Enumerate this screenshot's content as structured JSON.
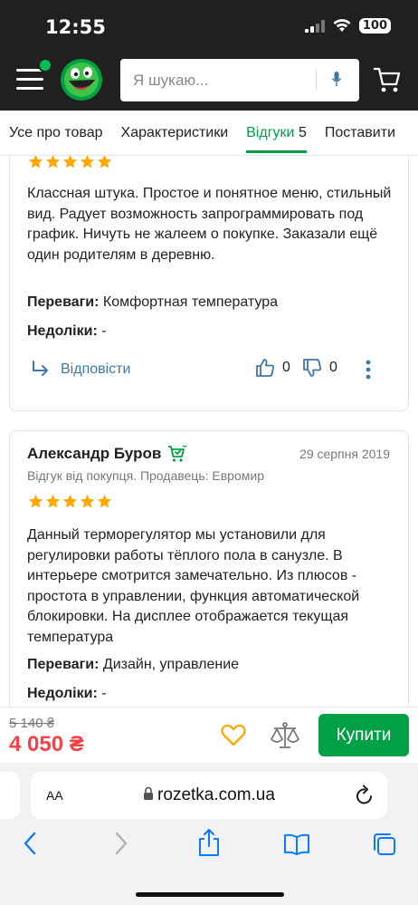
{
  "status": {
    "time": "12:55",
    "battery": "100"
  },
  "header": {
    "search_placeholder": "Я шукаю..."
  },
  "tabs": [
    {
      "label": "Усе про товар"
    },
    {
      "label": "Характеристики"
    },
    {
      "label": "Відгуки",
      "count": "5",
      "active": true
    },
    {
      "label": "Поставити"
    }
  ],
  "reviews": [
    {
      "text": "Классная штука. Простое и понятное меню, стильный вид. Радует возможность запрограммировать под график. Ничуть не жалеем о покупке. Заказали ещё один родителям в деревню.",
      "pros_label": "Переваги:",
      "pros": "Комфортная температура",
      "cons_label": "Недоліки:",
      "cons": "-",
      "reply_label": "Відповісти",
      "likes": "0",
      "dislikes": "0"
    },
    {
      "author": "Александр Буров",
      "date": "29 серпня 2019",
      "meta": "Відгук від покупця. Продавець: Евромир",
      "text": "Данный терморегулятор мы установили для регулировки работы тёплого пола в санузле. В интерьере смотрится замечательно. Из плюсов - простота в управлении, функция автоматической блокировки. На дисплее отображается текущая температура",
      "pros_label": "Переваги:",
      "pros": "Дизайн, управление",
      "cons_label": "Недоліки:",
      "cons": "-"
    }
  ],
  "product": {
    "old_price": "5 140 ₴",
    "price": "4 050 ₴",
    "buy_label": "Купити"
  },
  "browser": {
    "aa": "AA",
    "url": "rozetka.com.ua"
  },
  "colors": {
    "brand_green": "#00a046",
    "header_dark": "#221f1f",
    "price_red": "#f84147",
    "link_blue": "#3e77aa",
    "star": "#ffa900"
  }
}
